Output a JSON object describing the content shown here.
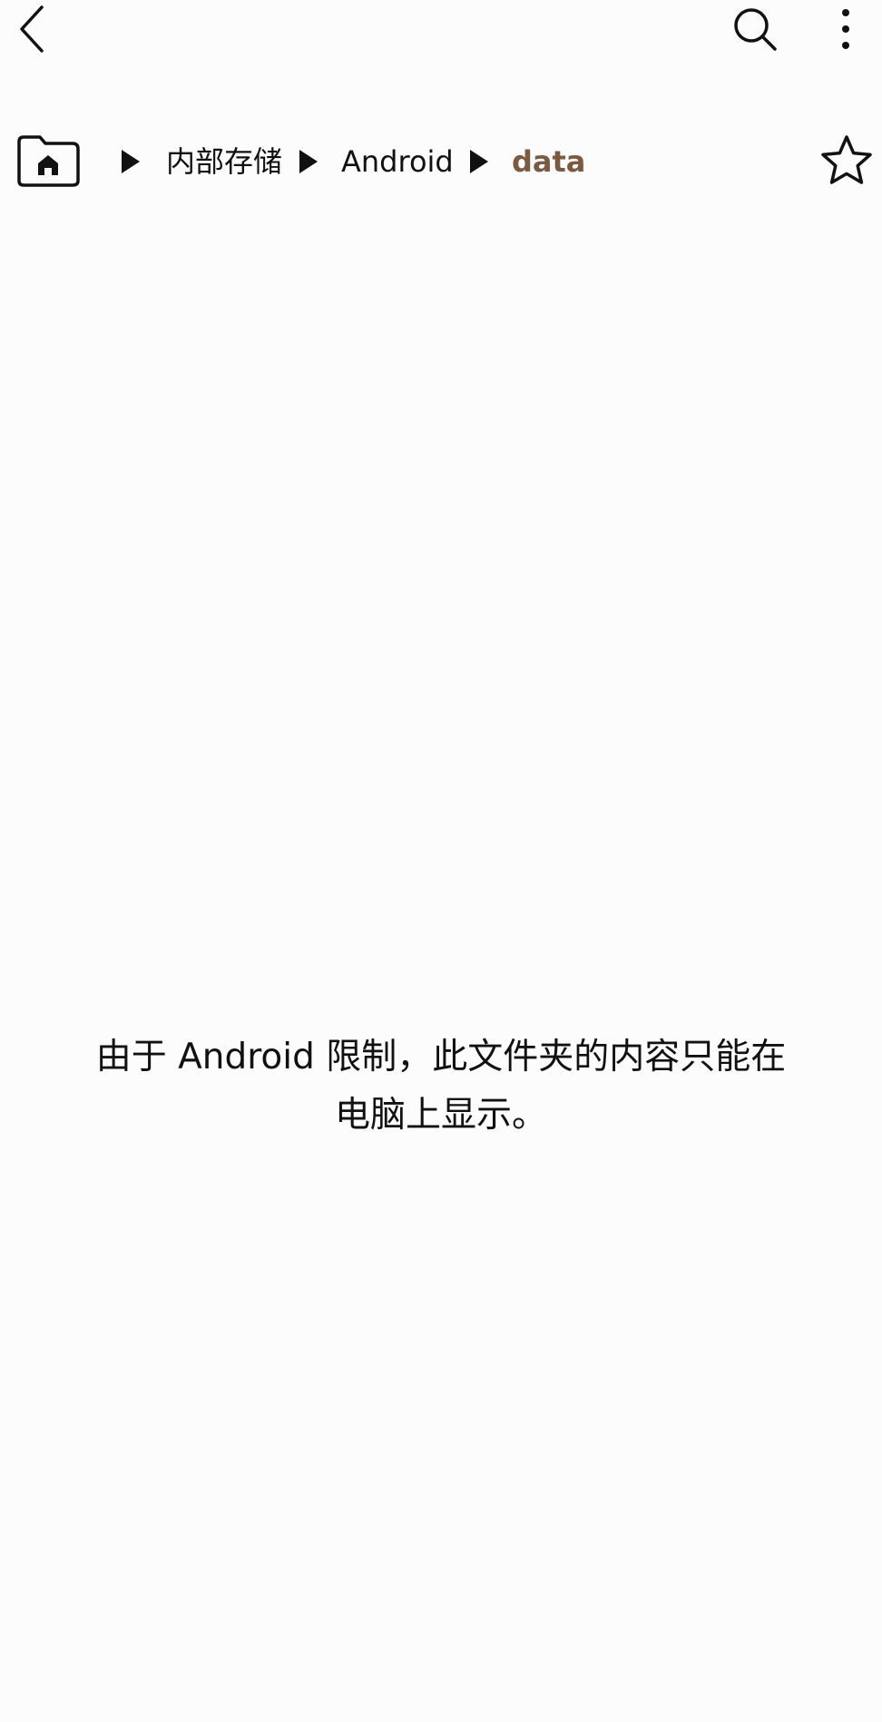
{
  "toolbar": {
    "back_icon": "chevron-left-icon",
    "search_icon": "search-icon",
    "more_icon": "more-vertical-icon"
  },
  "breadcrumb": {
    "home_icon": "home-folder-icon",
    "items": [
      {
        "label": "内部存储"
      },
      {
        "label": "Android"
      },
      {
        "label": "data"
      }
    ],
    "separator_icon": "triangle-right-icon",
    "favorite_icon": "star-outline-icon",
    "active_color": "#7a5a40"
  },
  "main": {
    "message_line1": "由于 Android 限制，此文件夹的内容只能在",
    "message_line2": "电脑上显示。"
  }
}
